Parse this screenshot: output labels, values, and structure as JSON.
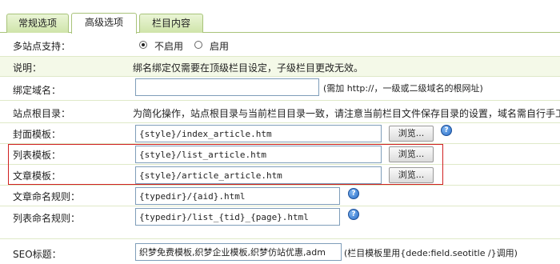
{
  "tabs": [
    {
      "label": "常规选项"
    },
    {
      "label": "高级选项"
    },
    {
      "label": "栏目内容"
    }
  ],
  "multisite": {
    "label": "多站点支持：",
    "options": [
      {
        "label": "不启用",
        "checked": true
      },
      {
        "label": "启用",
        "checked": false
      }
    ]
  },
  "note": {
    "label": "说明：",
    "text": "绑名绑定仅需要在顶级栏目设定，子级栏目更改无效。"
  },
  "bind_domain": {
    "label": "绑定域名：",
    "value": "",
    "hint": "(需加 http://，一级或二级域名的根网址)"
  },
  "site_root": {
    "label": "站点根目录：",
    "text": "为简化操作，站点根目录与当前栏目目录一致，请注意当前栏目文件保存目录的设置，域名需自行手工"
  },
  "cover_template": {
    "label": "封面模板：",
    "value": "{style}/index_article.htm",
    "browse": "浏览..."
  },
  "list_template": {
    "label": "列表模板：",
    "value": "{style}/list_article.htm",
    "browse": "浏览..."
  },
  "article_template": {
    "label": "文章模板：",
    "value": "{style}/article_article.htm",
    "browse": "浏览..."
  },
  "article_naming": {
    "label": "文章命名规则：",
    "value": "{typedir}/{aid}.html"
  },
  "list_naming": {
    "label": "列表命名规则：",
    "value": "{typedir}/list_{tid}_{page}.html"
  },
  "seo_title": {
    "label": "SEO标题：",
    "value": "织梦免费模板,织梦企业模板,织梦仿站优惠,adm",
    "hint": "(栏目模板里用{dede:field.seotitle /}调用)"
  },
  "help_glyph": "?"
}
